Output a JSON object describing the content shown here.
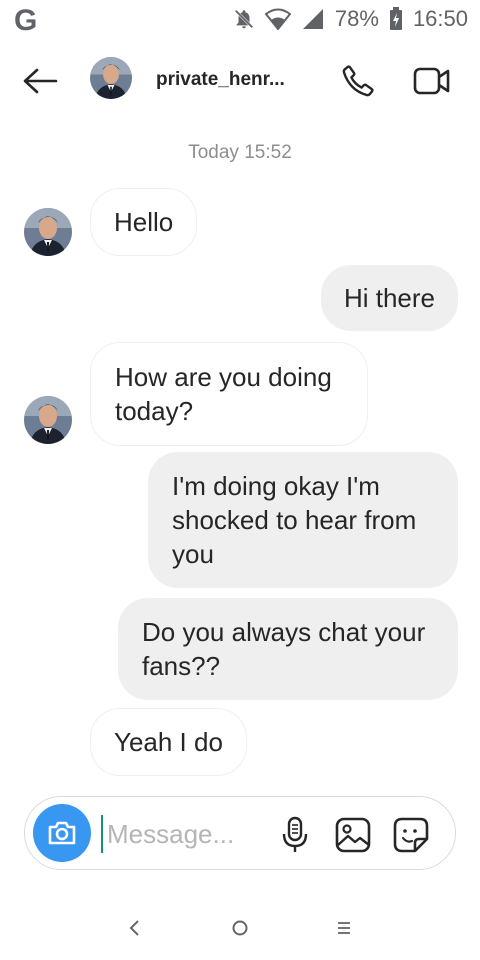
{
  "status_bar": {
    "carrier_icon": "google-g-icon",
    "battery": "78%",
    "time": "16:50"
  },
  "header": {
    "username": "private_henr...",
    "icons": {
      "back": "arrow-left-icon",
      "call": "phone-icon",
      "video": "video-camera-icon"
    }
  },
  "conversation": {
    "timestamp": "Today 15:52",
    "messages": [
      {
        "direction": "incoming",
        "text": "Hello"
      },
      {
        "direction": "outgoing",
        "text": "Hi there"
      },
      {
        "direction": "incoming",
        "text": "How are you doing today?"
      },
      {
        "direction": "outgoing",
        "text": "I'm doing okay I'm shocked to hear from you"
      },
      {
        "direction": "outgoing",
        "text": "Do you always chat your fans??"
      },
      {
        "direction": "incoming",
        "text": "Yeah I do"
      }
    ]
  },
  "composer": {
    "placeholder": "Message...",
    "icons": {
      "camera": "camera-icon",
      "mic": "microphone-icon",
      "gallery": "image-icon",
      "sticker": "sticker-icon"
    }
  },
  "colors": {
    "accent_blue": "#3897f0",
    "outgoing_bubble": "#efefef",
    "text": "#262626",
    "muted": "#8e8e8e"
  }
}
